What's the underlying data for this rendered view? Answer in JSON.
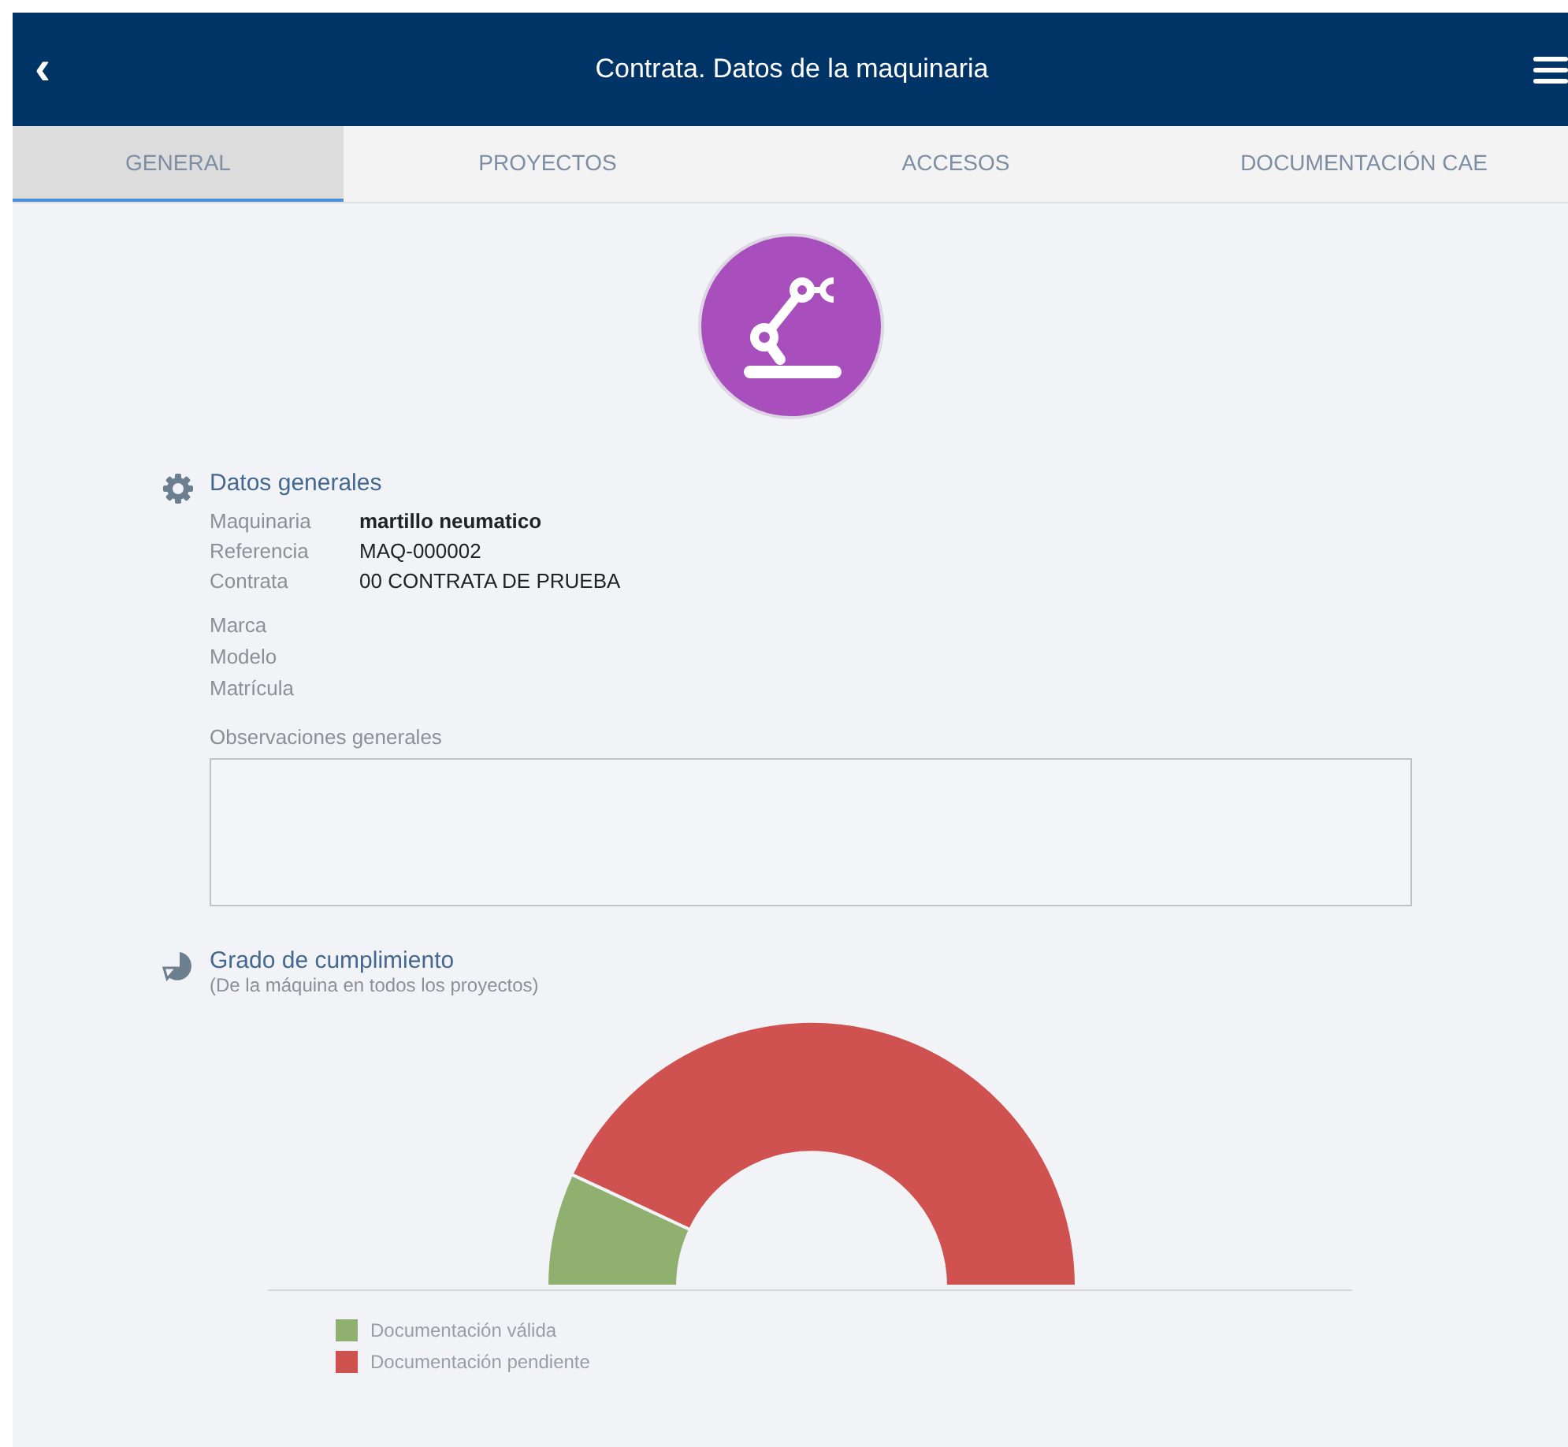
{
  "header": {
    "back": "‹",
    "title": "Contrata. Datos de la maquinaria"
  },
  "tabs": [
    {
      "label": "GENERAL",
      "selected": true
    },
    {
      "label": "PROYECTOS",
      "selected": false
    },
    {
      "label": "ACCESOS",
      "selected": false
    },
    {
      "label": "DOCUMENTACIÓN CAE",
      "selected": false
    }
  ],
  "general": {
    "title": "Datos generales",
    "fields": [
      {
        "label": "Maquinaria",
        "value": "martillo neumatico",
        "emphasis": true
      },
      {
        "label": "Referencia",
        "value": "MAQ-000002",
        "emphasis": false
      },
      {
        "label": "Contrata",
        "value": "00 CONTRATA DE PRUEBA",
        "emphasis": false
      }
    ],
    "extra_fields": [
      {
        "label": "Marca"
      },
      {
        "label": "Modelo"
      },
      {
        "label": "Matrícula"
      }
    ],
    "notes": {
      "label": "Observaciones generales"
    }
  },
  "compliance": {
    "title": "Grado de cumplimiento",
    "subtitle": "(De la máquina en todos los proyectos)",
    "legend": [
      {
        "label": "Documentación válida",
        "color": "#8fb06e"
      },
      {
        "label": "Documentación pendiente",
        "color": "#cf5250"
      }
    ]
  }
}
